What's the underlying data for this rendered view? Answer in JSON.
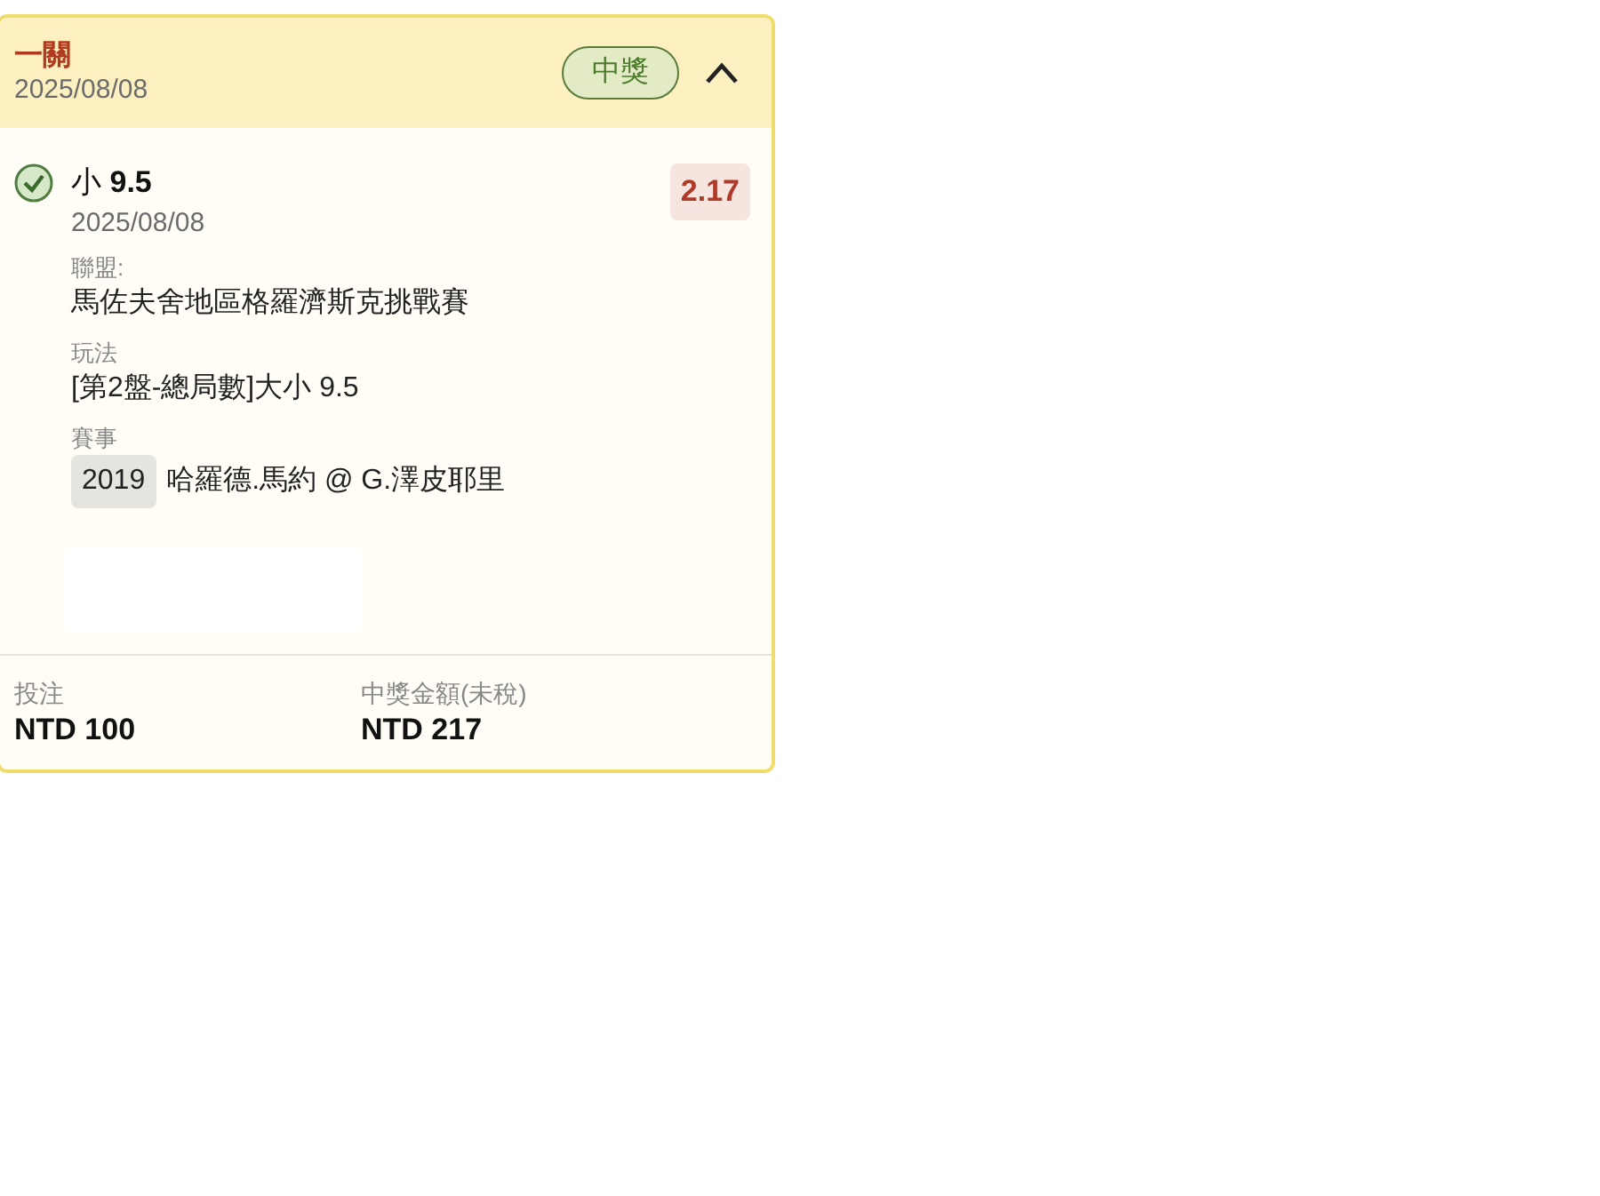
{
  "bet": {
    "type": "一關",
    "date": "2025/08/08",
    "status": "中獎",
    "expanded": true
  },
  "leg": {
    "won": true,
    "selection": "小 **9.5**",
    "date": "2025/08/08",
    "odds": "2.17",
    "fields": [
      {
        "label": "聯盟:",
        "value": "馬佐夫舍地區格羅濟斯克挑戰賽"
      },
      {
        "label": "玩法",
        "value": "[第2盤-總局數]大小 9.5"
      },
      {
        "label": "賽事",
        "tag": "2019",
        "value": "哈羅德.馬約 @ G.澤皮耶里"
      }
    ]
  },
  "totals": [
    {
      "label": "投注",
      "value": "NTD 100"
    },
    {
      "label": "中獎金額(未稅)",
      "value": "NTD 217"
    }
  ]
}
